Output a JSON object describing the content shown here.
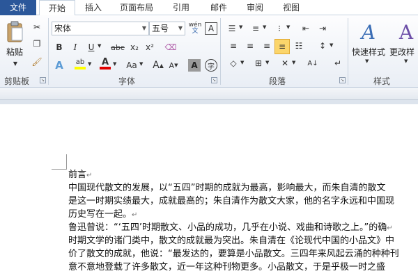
{
  "tabs": {
    "file": "文件",
    "home": "开始",
    "insert": "插入",
    "layout": "页面布局",
    "references": "引用",
    "mailings": "邮件",
    "review": "审阅",
    "view": "视图"
  },
  "clipboard": {
    "paste_label": "粘贴",
    "group_label": "剪贴板"
  },
  "font": {
    "font_name": "宋体",
    "font_size": "五号",
    "bold": "B",
    "italic": "I",
    "underline": "U",
    "strike": "abc",
    "subscript": "x₂",
    "superscript": "x²",
    "case": "Aa",
    "grow": "A",
    "shrink": "A",
    "phonetic": "wén",
    "group_label": "字体"
  },
  "paragraph": {
    "group_label": "段落"
  },
  "styles": {
    "quick_styles": "快速样式",
    "change_styles": "更改样",
    "group_label": "样式"
  },
  "colors": {
    "highlight": "#ffff00",
    "font_color": "#e00000",
    "file_tab": "#2b579a"
  },
  "document": {
    "lines": [
      "前言",
      "中国现代散文的发展，以“五四”时期的成就为最高，影响最大，而朱自清的散文",
      "是这一时期实绩最大，成就最高的；朱自清作为散文大家，他的名字永远和中国现",
      "历史写在一起。",
      "鲁迅曾说：“‘五四’时期散文、小品的成功，几乎在小说、戏曲和诗歌之上。”的确",
      "时期文学的诸门类中，散文的成就最为突出。朱自清在《论现代中国的小品文》中",
      "价了散文的成就，他说：“最发达的，要算是小品散文。三四年来风起云涌的种种刊",
      "意不意地登载了许多散文，近一年这种刊物更多。小品散文，于是乎极一时之盛"
    ],
    "para_ends": [
      0,
      3,
      4
    ]
  }
}
